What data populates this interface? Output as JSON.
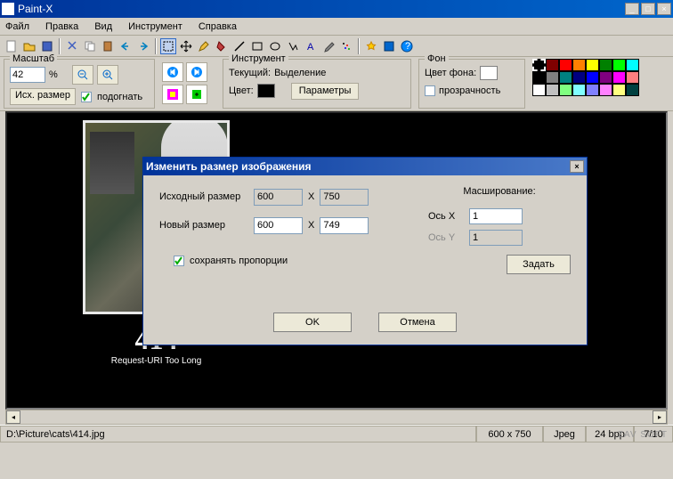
{
  "window": {
    "title": "Paint-X"
  },
  "menu": {
    "file": "Файл",
    "edit": "Правка",
    "view": "Вид",
    "tool": "Инструмент",
    "help": "Справка"
  },
  "zoom": {
    "legend": "Масштаб",
    "value": "42",
    "percent": "%",
    "orig_size": "Исх. размер",
    "fit": "подогнать",
    "fit_checked": true
  },
  "instrument": {
    "legend": "Инструмент",
    "current_label": "Текущий:",
    "current_value": "Выделение",
    "color_label": "Цвет:",
    "color_hex": "#000000",
    "params_btn": "Параметры"
  },
  "background": {
    "legend": "Фон",
    "bgcolor_label": "Цвет фона:",
    "bgcolor_hex": "#FFFFFF",
    "transparency_label": "прозрачность",
    "transparency_checked": false
  },
  "palette": [
    [
      "#000000",
      "#800000",
      "#ff0000",
      "#ff8000",
      "#ffff00",
      "#008000",
      "#00ff00",
      "#00ffff"
    ],
    [
      "#000000",
      "#808080",
      "#008080",
      "#000080",
      "#0000ff",
      "#800080",
      "#ff00ff",
      "#ff8080"
    ],
    [
      "#ffffff",
      "#c0c0c0",
      "#80ff80",
      "#80ffff",
      "#8080ff",
      "#ff80ff",
      "#ffff80",
      "#004040"
    ]
  ],
  "canvas": {
    "error_code": "414",
    "error_msg": "Request-URI Too Long"
  },
  "statusbar": {
    "path": "D:\\Picture\\cats\\414.jpg",
    "dims": "600 x 750",
    "format": "Jpeg",
    "depth": "24 bpp",
    "index": "7/10"
  },
  "dialog": {
    "title": "Изменить размер изображения",
    "src_label": "Исходный размер",
    "new_label": "Новый размер",
    "x_sep": "X",
    "src_w": "600",
    "src_h": "750",
    "new_w": "600",
    "new_h": "749",
    "keep_ratio_label": "сохранять пропорции",
    "keep_ratio_checked": true,
    "scaling_label": "Масширование:",
    "axis_x_label": "Ось X",
    "axis_x_val": "1",
    "axis_y_label": "Ось Y",
    "axis_y_val": "1",
    "set_btn": "Задать",
    "ok": "OK",
    "cancel": "Отмена"
  },
  "watermark": "ZAV SOFT"
}
